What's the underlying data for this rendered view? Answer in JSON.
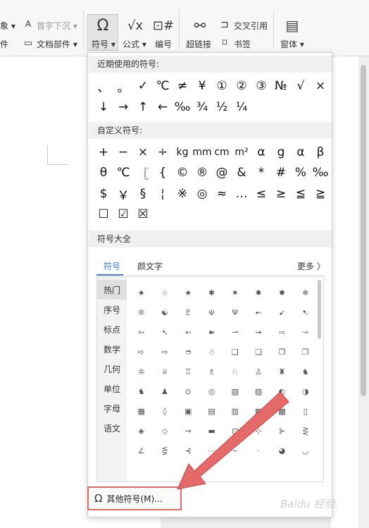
{
  "ribbon": {
    "object_label": "象",
    "attachment_label": "件",
    "dropcap_label": "首字下沉",
    "docpart_label": "文档部件",
    "symbol_label": "符号",
    "formula_label": "公式",
    "number_label": "编号",
    "hyperlink_label": "超链接",
    "crossref_label": "交叉引用",
    "bookmark_label": "书签",
    "window_label": "窗体"
  },
  "panel": {
    "recent_header": "近期使用的符号:",
    "recent_rows": [
      [
        "、",
        "。",
        "✓",
        "℃",
        "≠",
        "¥",
        "①",
        "②",
        "③",
        "№",
        "√",
        "×"
      ],
      [
        "↓",
        "→",
        "↑",
        "←",
        "‰",
        "¾",
        "½",
        "¼"
      ]
    ],
    "custom_header": "自定义符号:",
    "custom_rows": [
      [
        "+",
        "−",
        "×",
        "÷",
        "kg",
        "mm",
        "cm",
        "m²",
        "α",
        "g",
        "α",
        "β"
      ],
      [
        "θ",
        "℃",
        "〖",
        "{",
        "©",
        "®",
        "@",
        "&",
        "*",
        "#",
        "%",
        "‰"
      ],
      [
        "$",
        "￥",
        "§",
        "¦",
        "※",
        "◎",
        "≈",
        "…",
        "≤",
        "≥",
        "≦",
        "≧"
      ],
      [
        "☐",
        "☑",
        "☒"
      ]
    ],
    "all_header": "符号大全",
    "tabs": [
      "符号",
      "颜文字"
    ],
    "more_label": "更多 〉",
    "categories": [
      "热门",
      "序号",
      "标点",
      "数学",
      "几何",
      "单位",
      "字母",
      "语文"
    ],
    "grid_rows": [
      [
        "★",
        "☆",
        "★",
        "✱",
        "✷",
        "✸",
        "✹",
        "❄"
      ],
      [
        "❊",
        "☯",
        "♇",
        "☫",
        "Ψ",
        "➸",
        "➹",
        "➷"
      ],
      [
        "➳",
        "➴",
        "➵",
        "➽",
        "⇀",
        "⇝",
        "⇨",
        "⇾"
      ],
      [
        "➪",
        "⇨",
        "➮",
        "☃",
        "❏",
        "❑",
        "❒",
        "❐"
      ],
      [
        "♔",
        "♕",
        "♖",
        "♗",
        "♘",
        "♙",
        "♜",
        "♞"
      ],
      [
        "♞",
        "♟",
        "⊙",
        "◎",
        "▧",
        "▨",
        "◐",
        "◑"
      ],
      [
        "▦",
        "◊",
        "▣",
        "▤",
        "▥",
        "▦",
        "▩",
        "▯"
      ],
      [
        "◈",
        "◇",
        "→",
        "▬",
        "⊡",
        "⊹",
        "⊱",
        "⋛"
      ],
      [
        "∠",
        "⋚",
        "⊰",
        "⋯",
        "~",
        "·",
        "◕",
        "◡"
      ]
    ],
    "footer_icon": "Ω",
    "footer_label": "其他符号(M)..."
  },
  "watermark": "Baidu 经验",
  "accent_color": "#3b7dd8",
  "highlight_color": "#e46a6a"
}
